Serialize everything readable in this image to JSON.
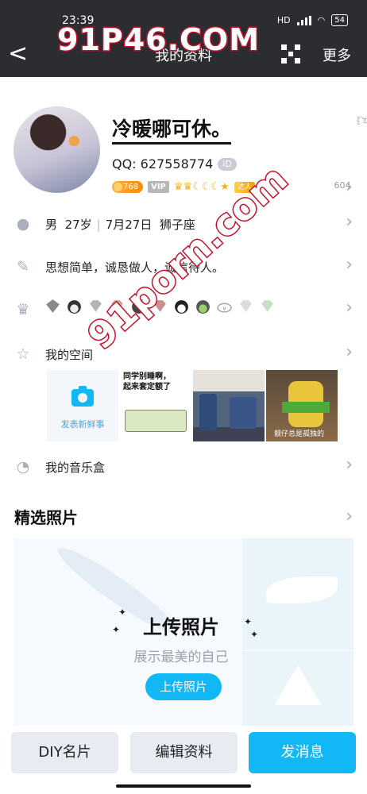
{
  "status_bar": {
    "time": "23:39",
    "net": "HD",
    "battery": "54"
  },
  "nav": {
    "back_glyph": "<",
    "title": "我的资料",
    "more_label": "更多",
    "qr_icon": "qr-code-icon"
  },
  "profile": {
    "nickname": "冷暖哪可休。",
    "qq": "QQ: 627558774",
    "id_badge": "iD",
    "level": "768",
    "vip": "VIP",
    "grade_icons": "♛♛☾☾☾★",
    "daren": "达人",
    "likes": "604"
  },
  "info": {
    "gender": "男",
    "age": "27岁",
    "birthday": "7月27日",
    "zodiac": "狮子座",
    "signature": "思想简单，诚恳做人，诚信待人。"
  },
  "space": {
    "label": "我的空间",
    "post_label": "发表新鲜事",
    "meme_text_line1": "同学别睡啊，",
    "meme_text_line2": "起来套定额了",
    "caption": "靓仔总是孤独的"
  },
  "music": {
    "label": "我的音乐盒"
  },
  "photos": {
    "title": "精选照片",
    "heading": "上传照片",
    "subtitle": "展示最美的自己",
    "button": "上传照片"
  },
  "bottom": {
    "diy": "DIY名片",
    "edit": "编辑资料",
    "message": "发消息"
  },
  "watermark": {
    "line1": "91P46.COM",
    "line2": "91porn.com"
  },
  "colors": {
    "accent": "#12b7f5",
    "header_bg": "#2b2d31",
    "watermark": "#c8102e"
  }
}
